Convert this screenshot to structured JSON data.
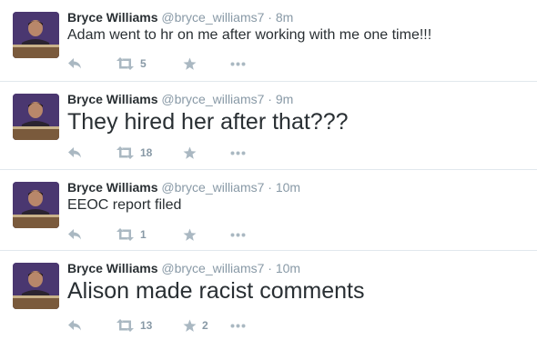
{
  "tweets": [
    {
      "name": "Bryce Williams",
      "handle": "@bryce_williams7",
      "time": "8m",
      "text": "Adam went to hr on me after working with me one time!!!",
      "retweets": "5",
      "favorites": ""
    },
    {
      "name": "Bryce Williams",
      "handle": "@bryce_williams7",
      "time": "9m",
      "text": "They hired her after that???",
      "retweets": "18",
      "favorites": ""
    },
    {
      "name": "Bryce Williams",
      "handle": "@bryce_williams7",
      "time": "10m",
      "text": "EEOC report filed",
      "retweets": "1",
      "favorites": ""
    },
    {
      "name": "Bryce Williams",
      "handle": "@bryce_williams7",
      "time": "10m",
      "text": "Alison made racist comments",
      "retweets": "13",
      "favorites": "2"
    }
  ],
  "separator": "·",
  "icons": {
    "reply": "reply-icon",
    "retweet": "retweet-icon",
    "favorite": "star-icon",
    "more": "more-icon"
  },
  "colors": {
    "name": "#292f33",
    "muted": "#8899a6",
    "icon": "#aab8c2",
    "divider": "#e1e8ed"
  }
}
